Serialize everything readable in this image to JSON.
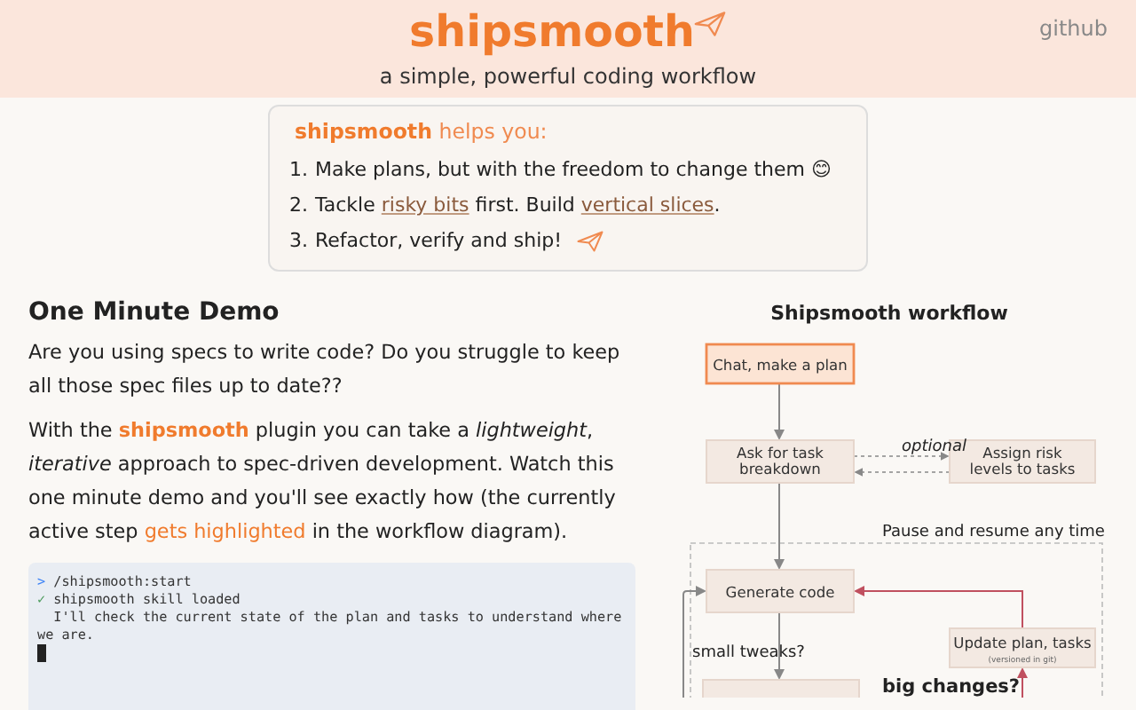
{
  "header": {
    "title": "shipsmooth",
    "subtitle": "a simple, powerful coding workflow",
    "link": "github"
  },
  "intro": {
    "brand": "shipsmooth",
    "heading": "helps you:",
    "items": [
      {
        "number": "1.",
        "parts": [
          {
            "kind": "text",
            "text": "Make plans, but with the freedom to change them 😊"
          }
        ]
      },
      {
        "number": "2.",
        "parts": [
          {
            "kind": "text",
            "text": "Tackle "
          },
          {
            "kind": "link",
            "text": "risky bits"
          },
          {
            "kind": "text",
            "text": " first. Build "
          },
          {
            "kind": "link",
            "text": "vertical slices"
          },
          {
            "kind": "text",
            "text": "."
          }
        ]
      },
      {
        "number": "3.",
        "parts": [
          {
            "kind": "text",
            "text": "Refactor, verify and ship!"
          },
          {
            "kind": "plane"
          }
        ]
      }
    ]
  },
  "demo": {
    "heading": "One Minute Demo",
    "paragraphs": [
      [
        {
          "kind": "text",
          "text": "Are you using specs to write code? Do you struggle to keep all those spec files up to date??"
        }
      ],
      [
        {
          "kind": "text",
          "text": "With the "
        },
        {
          "kind": "brand",
          "text": "shipsmooth"
        },
        {
          "kind": "text",
          "text": " plugin you can take a "
        },
        {
          "kind": "em",
          "text": "lightweight"
        },
        {
          "kind": "text",
          "text": ", "
        },
        {
          "kind": "em",
          "text": "iterative"
        },
        {
          "kind": "text",
          "text": " approach to spec-driven development. Watch this one minute demo and you'll see exactly how (the currently active step "
        },
        {
          "kind": "link",
          "text": "gets highlighted"
        },
        {
          "kind": "text",
          "text": " in the workflow diagram)."
        }
      ]
    ],
    "terminal": {
      "lines": [
        {
          "kind": "command",
          "mark": ">",
          "text": "/shipsmooth:start"
        },
        {
          "kind": "status",
          "mark": "✓",
          "text": "shipsmooth skill loaded"
        },
        {
          "kind": "output",
          "text": "  I'll check the current state of the plan and tasks to understand where we are."
        }
      ],
      "cursor": true
    }
  },
  "workflow": {
    "title": "Shipsmooth workflow",
    "nodes": [
      {
        "lines": [
          "Chat, make a plan"
        ],
        "highlighted": true
      },
      {
        "lines": [
          "Ask for task",
          "breakdown"
        ],
        "highlighted": false
      },
      {
        "lines": [
          "Assign risk",
          "levels to tasks"
        ],
        "highlighted": false
      },
      {
        "lines": [
          "Generate code"
        ],
        "highlighted": false
      },
      {
        "lines": [
          "Update plan, tasks"
        ],
        "note": "(versioned in git)",
        "highlighted": false
      },
      {
        "highlighted": false
      }
    ],
    "labels": [
      {
        "kind": "italic",
        "text": "optional"
      },
      {
        "kind": "plain",
        "text": "Pause and resume any time"
      },
      {
        "kind": "plain",
        "text": "small tweaks?"
      },
      {
        "kind": "bold",
        "text": "big changes?"
      }
    ]
  }
}
